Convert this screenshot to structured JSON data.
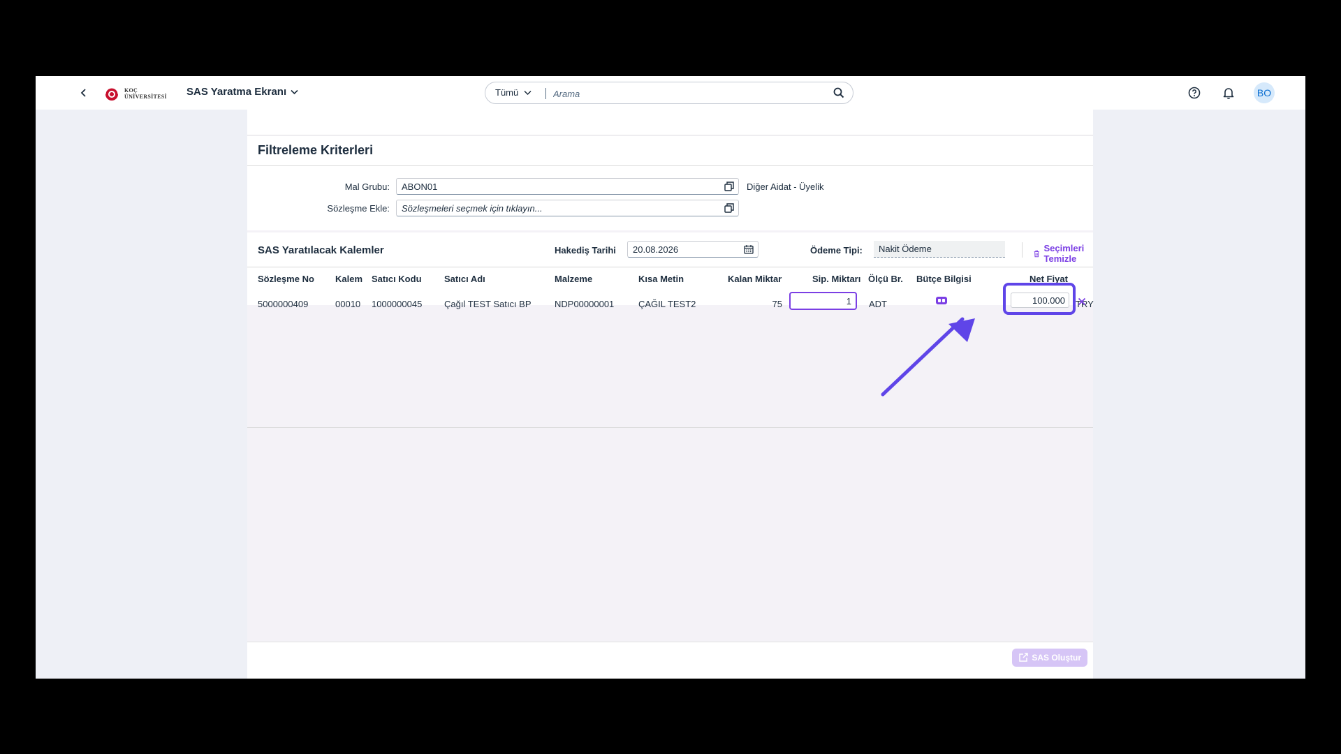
{
  "shellbar": {
    "logo_line1": "KOÇ",
    "logo_line2": "ÜNİVERSİTESİ",
    "app_title": "SAS Yaratma Ekranı",
    "search_scope": "Tümü",
    "search_placeholder": "Arama",
    "avatar_initials": "BO"
  },
  "filter": {
    "title": "Filtreleme Kriterleri",
    "mal_grubu_label": "Mal Grubu:",
    "mal_grubu_value": "ABON01",
    "mal_grubu_desc": "Diğer Aidat - Üyelik",
    "sozlesme_label": "Sözleşme Ekle:",
    "sozlesme_placeholder": "Sözleşmeleri seçmek için tıklayın..."
  },
  "table": {
    "title": "SAS Yaratılacak Kalemler",
    "hakedis_label": "Hakediş Tarihi",
    "hakedis_value": "20.08.2026",
    "odeme_label": "Ödeme Tipi:",
    "odeme_value": "Nakit Ödeme",
    "clear_label": "Seçimleri Temizle",
    "columns": [
      "Sözleşme No",
      "Kalem",
      "Satıcı Kodu",
      "Satıcı Adı",
      "Malzeme",
      "Kısa Metin",
      "Kalan Miktar",
      "Sip. Miktarı",
      "Ölçü Br.",
      "Bütçe Bilgisi",
      "Net Fiyat"
    ],
    "row": {
      "sozlesme_no": "5000000409",
      "kalem": "00010",
      "satici_kodu": "1000000045",
      "satici_adi": "Çağıl TEST Satıcı BP",
      "malzeme": "NDP00000001",
      "kisa_metin": "ÇAĞIL TEST2",
      "kalan_miktar": "75",
      "sip_miktari": "1",
      "olcu_br": "ADT",
      "net_fiyat": "100.000",
      "currency": "TRY"
    }
  },
  "footer": {
    "create_label": "SAS Oluştur"
  },
  "colors": {
    "accent": "#7b3fe4",
    "highlight": "#5f45e8"
  }
}
